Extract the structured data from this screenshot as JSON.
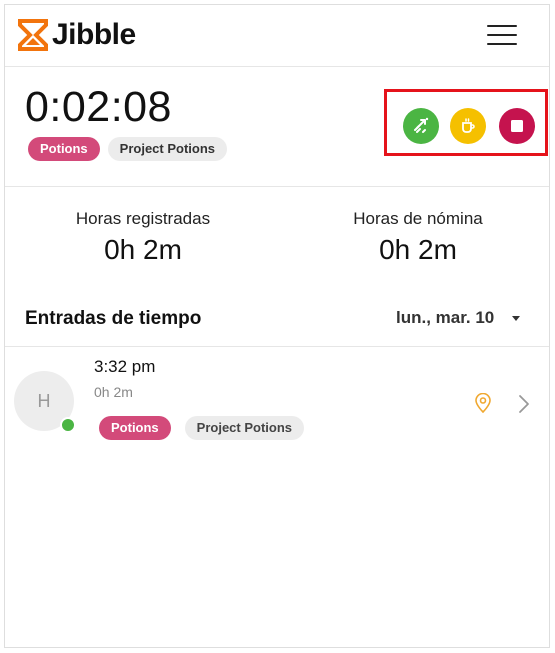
{
  "app": {
    "name": "Jibble",
    "brand_color": "#f2740d"
  },
  "timer": {
    "elapsed": "0:02:08",
    "activity_tag": "Potions",
    "project_tag": "Project Potions"
  },
  "actions": {
    "switch_icon": "switch-icon",
    "break_icon": "coffee-icon",
    "stop_icon": "stop-icon",
    "colors": {
      "switch": "#4bb543",
      "break": "#f5c000",
      "stop": "#c5134e",
      "highlight_border": "#e5131b"
    }
  },
  "stats": {
    "tracked_label": "Horas registradas",
    "tracked_value": "0h 2m",
    "payroll_label": "Horas de nómina",
    "payroll_value": "0h 2m"
  },
  "entries": {
    "title": "Entradas de tiempo",
    "date": "lun., mar. 10",
    "items": [
      {
        "avatar_initial": "H",
        "time": "3:32 pm",
        "duration": "0h 2m",
        "activity_tag": "Potions",
        "project_tag": "Project Potions",
        "status_color": "#4bb543"
      }
    ]
  }
}
